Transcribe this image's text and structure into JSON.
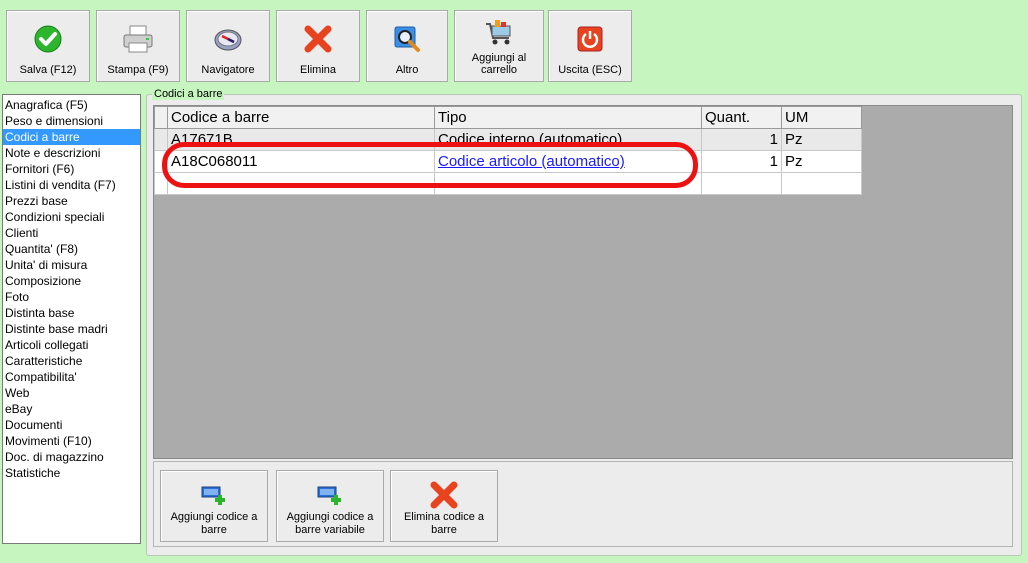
{
  "toolbar": {
    "buttons": [
      {
        "label": "Salva (F12)",
        "icon": "check-icon"
      },
      {
        "label": "Stampa (F9)",
        "icon": "printer-icon"
      },
      {
        "label": "Navigatore",
        "icon": "compass-icon"
      },
      {
        "label": "Elimina",
        "icon": "delete-x-icon"
      },
      {
        "label": "Altro",
        "icon": "magnifier-icon"
      },
      {
        "label": "Aggiungi al carrello",
        "icon": "cart-icon"
      },
      {
        "label": "Uscita (ESC)",
        "icon": "power-icon"
      }
    ]
  },
  "sidebar": {
    "items": [
      {
        "label": "Anagrafica (F5)"
      },
      {
        "label": "Peso e dimensioni"
      },
      {
        "label": "Codici a barre"
      },
      {
        "label": "Note e descrizioni"
      },
      {
        "label": "Fornitori (F6)"
      },
      {
        "label": "Listini di vendita (F7)"
      },
      {
        "label": "Prezzi base"
      },
      {
        "label": "Condizioni speciali"
      },
      {
        "label": "Clienti"
      },
      {
        "label": "Quantita' (F8)"
      },
      {
        "label": "Unita' di misura"
      },
      {
        "label": "Composizione"
      },
      {
        "label": "Foto"
      },
      {
        "label": "Distinta base"
      },
      {
        "label": "Distinte base madri"
      },
      {
        "label": "Articoli collegati"
      },
      {
        "label": "Caratteristiche"
      },
      {
        "label": "Compatibilita'"
      },
      {
        "label": "Web"
      },
      {
        "label": "eBay"
      },
      {
        "label": "Documenti"
      },
      {
        "label": "Movimenti (F10)"
      },
      {
        "label": "Doc. di magazzino"
      },
      {
        "label": "Statistiche"
      }
    ],
    "active_index": 2
  },
  "group": {
    "title": "Codici a barre"
  },
  "grid": {
    "columns": [
      "Codice a barre",
      "Tipo",
      "Quant.",
      "UM"
    ],
    "rows": [
      {
        "code": "A17671B",
        "type": "Codice interno (automatico)",
        "qty": "1",
        "um": "Pz"
      },
      {
        "code": "A18C068011",
        "type": "Codice articolo (automatico)",
        "qty": "1",
        "um": "Pz"
      }
    ]
  },
  "bottom": {
    "buttons": [
      {
        "label": "Aggiungi codice a barre",
        "icon": "add-barcode-icon"
      },
      {
        "label": "Aggiungi codice a barre variabile",
        "icon": "add-variable-barcode-icon"
      },
      {
        "label": "Elimina codice a barre",
        "icon": "delete-x-icon"
      }
    ]
  },
  "colors": {
    "background": "#c6f5c0",
    "selection": "#3399ff",
    "highlight": "#ee1111",
    "link": "#1a1aff"
  }
}
